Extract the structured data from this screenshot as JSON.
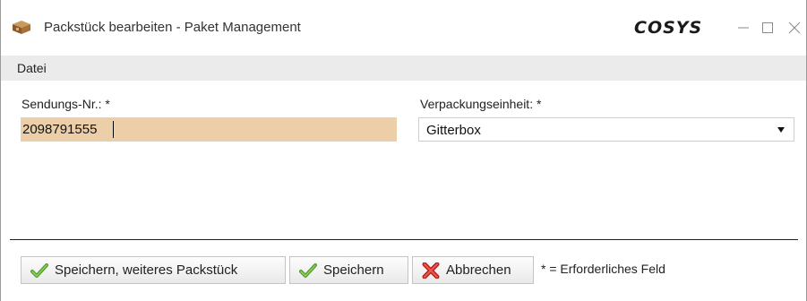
{
  "window": {
    "title": "Packstück bearbeiten - Paket Management",
    "logo": "COSYS"
  },
  "menu": {
    "file_label": "Datei"
  },
  "form": {
    "shipment_number": {
      "label": "Sendungs-Nr.: *",
      "value": "2098791555"
    },
    "packaging_unit": {
      "label": "Verpackungseinheit: *",
      "selected": "Gitterbox"
    }
  },
  "footer": {
    "save_next_label": "Speichern, weiteres Packstück",
    "save_label": "Speichern",
    "cancel_label": "Abbrechen",
    "required_note": "* = Erforderliches Feld"
  },
  "icons": {
    "app": "package-icon",
    "save": "green-check-icon",
    "cancel": "red-x-icon"
  },
  "colors": {
    "active_input": "#eccfa9",
    "menubar": "#ebebeb",
    "check_green": "#6fb43f",
    "cancel_red": "#d9302c"
  }
}
